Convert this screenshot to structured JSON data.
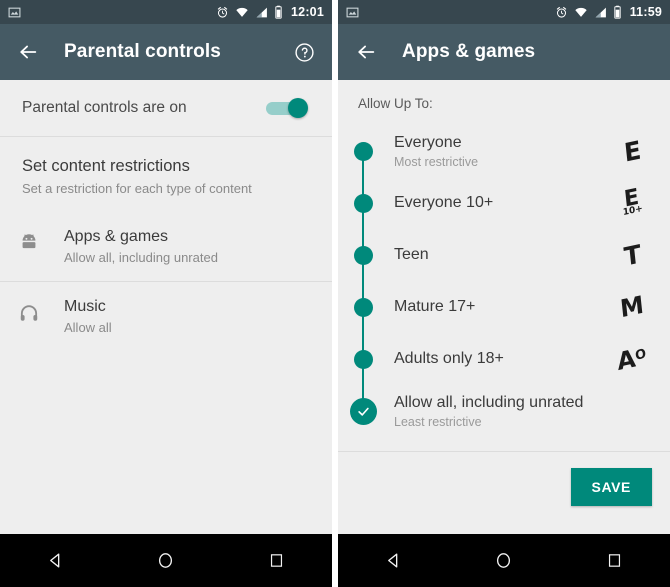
{
  "left": {
    "status": {
      "time": "12:01",
      "icons": [
        "screenshot-icon",
        "alarm-icon",
        "wifi-icon",
        "signal-icon",
        "battery-icon"
      ]
    },
    "appbar": {
      "back": "back-arrow",
      "title": "Parental controls",
      "help": "help-icon"
    },
    "toggle": {
      "label": "Parental controls are on",
      "state": "on"
    },
    "section": {
      "heading": "Set content restrictions",
      "sub": "Set a restriction for each type of content"
    },
    "items": [
      {
        "icon": "android-robot-icon",
        "title": "Apps & games",
        "sub": "Allow all, including unrated"
      },
      {
        "icon": "headphones-icon",
        "title": "Music",
        "sub": "Allow all"
      }
    ]
  },
  "right": {
    "status": {
      "time": "11:59",
      "icons": [
        "screenshot-icon",
        "alarm-icon",
        "wifi-icon",
        "signal-icon",
        "battery-icon"
      ]
    },
    "appbar": {
      "back": "back-arrow",
      "title": "Apps & games"
    },
    "allow_label": "Allow Up To:",
    "ratings": [
      {
        "label": "Everyone",
        "sub": "Most restrictive",
        "badge": "E",
        "selected": false
      },
      {
        "label": "Everyone 10+",
        "sub": "",
        "badge": "E10+",
        "selected": false
      },
      {
        "label": "Teen",
        "sub": "",
        "badge": "T",
        "selected": false
      },
      {
        "label": "Mature 17+",
        "sub": "",
        "badge": "M",
        "selected": false
      },
      {
        "label": "Adults only 18+",
        "sub": "",
        "badge": "AO",
        "selected": false
      },
      {
        "label": "Allow all, including unrated",
        "sub": "Least restrictive",
        "badge": "",
        "selected": true
      }
    ],
    "save_label": "SAVE"
  },
  "navbar": {
    "back": "back-triangle-icon",
    "home": "home-circle-icon",
    "recents": "recents-square-icon"
  },
  "colors": {
    "statusbar": "#37474f",
    "appbar": "#455a64",
    "accent": "#00897b",
    "track": "#96ceca",
    "background": "#eeeeee",
    "navbar": "#000000"
  }
}
